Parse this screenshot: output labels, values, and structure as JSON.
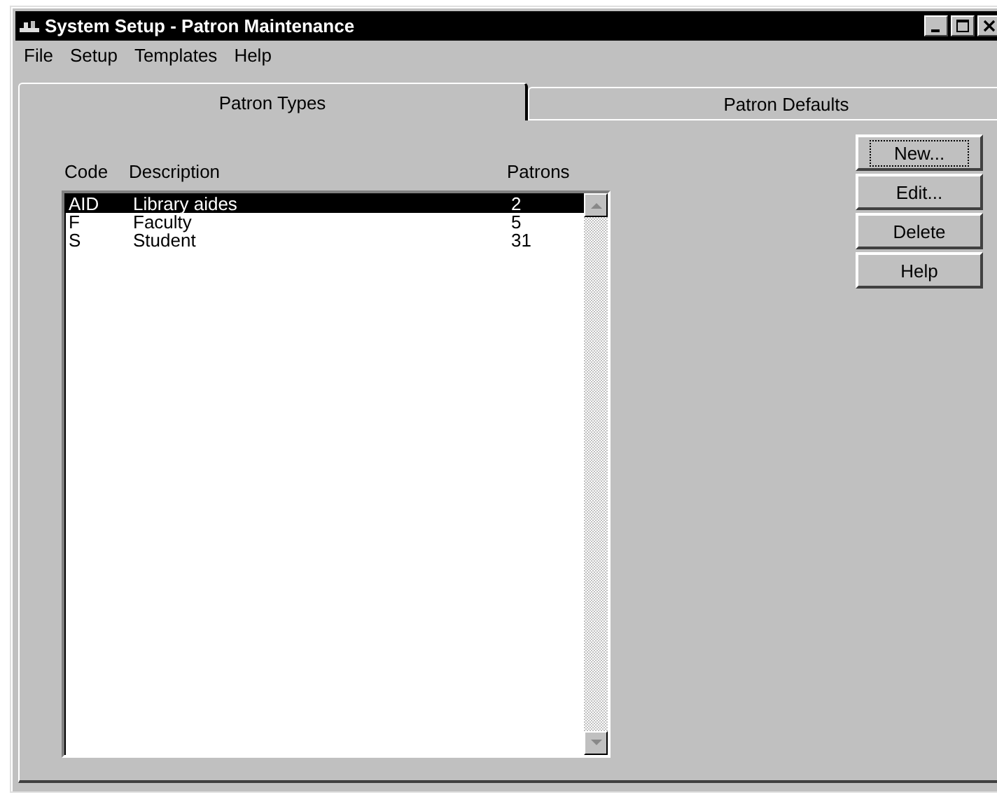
{
  "window": {
    "title": "System Setup - Patron Maintenance"
  },
  "menu": [
    "File",
    "Setup",
    "Templates",
    "Help"
  ],
  "tabs": [
    {
      "label": "Patron Types",
      "selected": true
    },
    {
      "label": "Patron Defaults",
      "selected": false
    }
  ],
  "table": {
    "columns": [
      "Code",
      "Description",
      "Patrons"
    ],
    "rows": [
      {
        "cells": [
          "AID",
          "Library aides",
          "2"
        ],
        "selected": true
      },
      {
        "cells": [
          "F",
          "Faculty",
          "5"
        ],
        "selected": false
      },
      {
        "cells": [
          "S",
          "Student",
          "31"
        ],
        "selected": false
      }
    ]
  },
  "buttons": [
    {
      "label": "New...",
      "focused": true
    },
    {
      "label": "Edit...",
      "focused": false
    },
    {
      "label": "Delete",
      "focused": false
    },
    {
      "label": "Help",
      "focused": false
    }
  ]
}
